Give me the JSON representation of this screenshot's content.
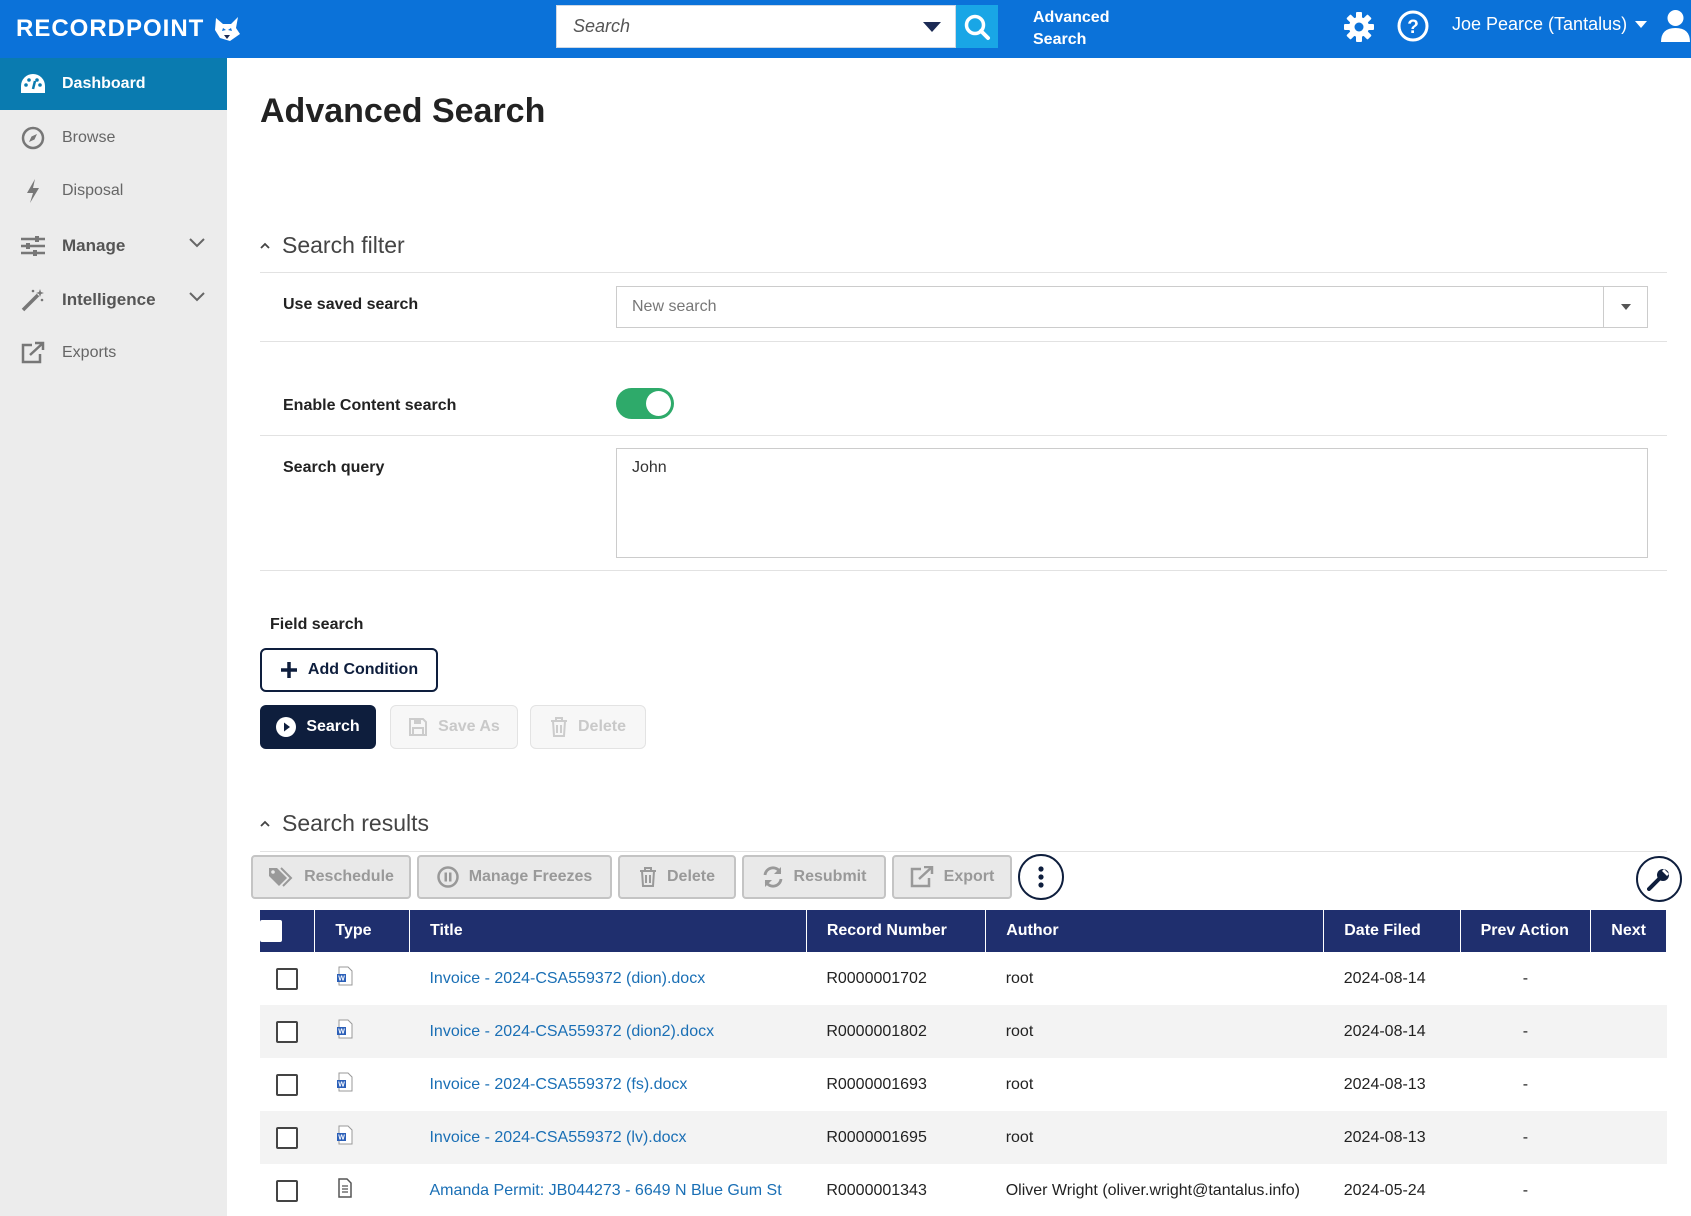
{
  "header": {
    "brand": "RECORDPOINT",
    "search_placeholder": "Search",
    "advanced_line1": "Advanced",
    "advanced_line2": "Search",
    "user_name": "Joe Pearce (Tantalus)"
  },
  "sidebar": {
    "items": [
      {
        "label": "Dashboard",
        "icon": "dashboard-icon",
        "active": true
      },
      {
        "label": "Browse",
        "icon": "compass-icon"
      },
      {
        "label": "Disposal",
        "icon": "lightning-icon"
      },
      {
        "label": "Manage",
        "icon": "sliders-icon",
        "expandable": true
      },
      {
        "label": "Intelligence",
        "icon": "magic-wand-icon",
        "expandable": true
      },
      {
        "label": "Exports",
        "icon": "external-link-icon"
      }
    ]
  },
  "main": {
    "title": "Advanced Search",
    "filter": {
      "section_title": "Search filter",
      "saved_search_label": "Use saved search",
      "saved_search_value": "New search",
      "content_search_label": "Enable Content search",
      "content_search_enabled": true,
      "query_label": "Search query",
      "query_value": "John",
      "field_search_label": "Field search",
      "add_condition": "Add Condition",
      "search_btn": "Search",
      "save_as_btn": "Save As",
      "delete_btn": "Delete"
    },
    "results": {
      "section_title": "Search results",
      "toolbar": {
        "reschedule": "Reschedule",
        "manage_freezes": "Manage Freezes",
        "delete": "Delete",
        "resubmit": "Resubmit",
        "export": "Export"
      },
      "columns": [
        "Type",
        "Title",
        "Record Number",
        "Author",
        "Date Filed",
        "Prev Action",
        "Next"
      ],
      "rows": [
        {
          "type": "word-doc-icon",
          "title": "Invoice - 2024-CSA559372 (dion).docx",
          "record": "R0000001702",
          "author": "root",
          "date": "2024-08-14",
          "prev": "-"
        },
        {
          "type": "word-doc-icon",
          "title": "Invoice - 2024-CSA559372 (dion2).docx",
          "record": "R0000001802",
          "author": "root",
          "date": "2024-08-14",
          "prev": "-"
        },
        {
          "type": "word-doc-icon",
          "title": "Invoice - 2024-CSA559372 (fs).docx",
          "record": "R0000001693",
          "author": "root",
          "date": "2024-08-13",
          "prev": "-"
        },
        {
          "type": "word-doc-icon",
          "title": "Invoice - 2024-CSA559372 (lv).docx",
          "record": "R0000001695",
          "author": "root",
          "date": "2024-08-13",
          "prev": "-"
        },
        {
          "type": "text-doc-icon",
          "title": "Amanda Permit: JB044273 - 6649 N Blue Gum St",
          "record": "R0000001343",
          "author": "Oliver Wright (oliver.wright@tantalus.info)",
          "date": "2024-05-24",
          "prev": "-"
        }
      ]
    }
  },
  "colors": {
    "topbar": "#0b72d9",
    "search_button": "#19a6e6",
    "sidebar_active": "#0a7bb0",
    "table_header": "#1f2f6e",
    "navy_button": "#0e1e3d",
    "toggle_on": "#2eaa6a",
    "link": "#1a6fb5"
  }
}
